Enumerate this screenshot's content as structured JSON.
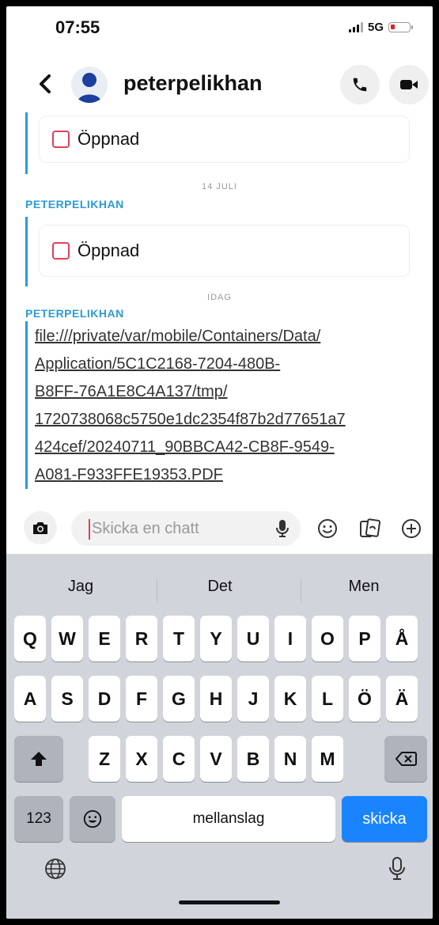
{
  "status_bar": {
    "time": "07:55",
    "network": "5G"
  },
  "header": {
    "contact_name": "peterpelikhan"
  },
  "chat": {
    "card1_label": "Öppnad",
    "date1": "14 JULI",
    "sender1": "PETERPELIKHAN",
    "card2_label": "Öppnad",
    "date2": "IDAG",
    "sender2": "PETERPELIKHAN",
    "link_lines": [
      "file:///private/var/mobile/Containers/Data/",
      "Application/5C1C2168-7204-480B-",
      "B8FF-76A1E8C4A137/tmp/",
      "1720738068c5750e1dc2354f87b2d77651a7",
      "424cef/20240711_90BBCA42-CB8F-9549-",
      "A081-F933FFE19353.PDF"
    ]
  },
  "input": {
    "placeholder": "Skicka en chatt"
  },
  "keyboard": {
    "suggestions": [
      "Jag",
      "Det",
      "Men"
    ],
    "row1": [
      "Q",
      "W",
      "E",
      "R",
      "T",
      "Y",
      "U",
      "I",
      "O",
      "P",
      "Å"
    ],
    "row2": [
      "A",
      "S",
      "D",
      "F",
      "G",
      "H",
      "J",
      "K",
      "L",
      "Ö",
      "Ä"
    ],
    "row3": [
      "Z",
      "X",
      "C",
      "V",
      "B",
      "N",
      "M"
    ],
    "numbers_key": "123",
    "space_key": "mellanslag",
    "send_key": "skicka"
  },
  "colors": {
    "accent_blue": "#2a9bd8",
    "unread_red": "#e0405a",
    "send_blue": "#1a84ff"
  }
}
